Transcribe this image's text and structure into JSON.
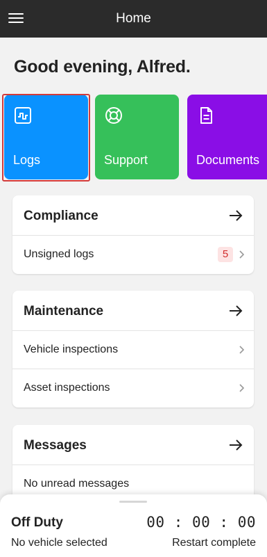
{
  "header": {
    "title": "Home",
    "menu_icon": "hamburger-menu-icon"
  },
  "greeting": "Good evening, Alfred.",
  "tiles": [
    {
      "label": "Logs",
      "icon": "logs-icon",
      "color": "#0a92ff",
      "selected": true
    },
    {
      "label": "Support",
      "icon": "lifebuoy-icon",
      "color": "#36c05a"
    },
    {
      "label": "Documents",
      "icon": "document-icon",
      "color": "#8a0ee6"
    }
  ],
  "compliance": {
    "title": "Compliance",
    "rows": [
      {
        "label": "Unsigned logs",
        "badge": "5"
      }
    ]
  },
  "maintenance": {
    "title": "Maintenance",
    "rows": [
      {
        "label": "Vehicle inspections"
      },
      {
        "label": "Asset inspections"
      }
    ]
  },
  "messages": {
    "title": "Messages",
    "rows": [
      {
        "label": "No unread messages"
      }
    ]
  },
  "status_sheet": {
    "duty_status": "Off Duty",
    "timer": "00:00:00",
    "vehicle": "No vehicle selected",
    "restart": "Restart complete"
  },
  "colors": {
    "header_bg": "#2b2b2b",
    "selection_outline": "#d23a3a",
    "badge_text": "#d12b2b",
    "badge_bg": "#fde3e3"
  }
}
